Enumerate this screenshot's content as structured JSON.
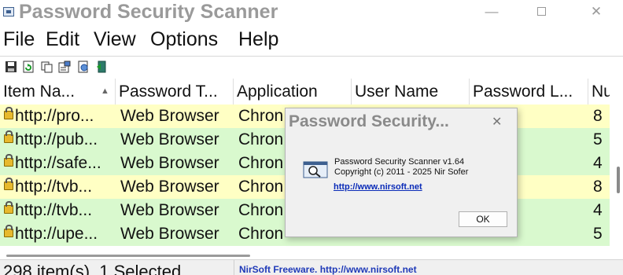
{
  "window": {
    "title": "Password Security Scanner",
    "minimize_glyph": "—",
    "close_glyph": "✕"
  },
  "menu": [
    "File",
    "Edit",
    "View",
    "Options",
    "Help"
  ],
  "toolbar": {
    "buttons": [
      "save-icon",
      "refresh-icon",
      "copy-icon",
      "properties-icon",
      "html-report-icon",
      "exit-icon"
    ]
  },
  "table": {
    "sort_indicator": "▲",
    "columns": [
      "Item Na...",
      "Password T...",
      "Application",
      "User Name",
      "Password L...",
      "Nu"
    ],
    "rows": [
      {
        "item": "http://pro...",
        "type": "Web Browser",
        "app": "Chron",
        "length": "8"
      },
      {
        "item": "http://pub...",
        "type": "Web Browser",
        "app": "Chron",
        "length": "5"
      },
      {
        "item": "http://safe...",
        "type": "Web Browser",
        "app": "Chron",
        "length": "4"
      },
      {
        "item": "http://tvb...",
        "type": "Web Browser",
        "app": "Chron",
        "length": "8"
      },
      {
        "item": "http://tvb...",
        "type": "Web Browser",
        "app": "Chron",
        "length": "4"
      },
      {
        "item": "http://upe...",
        "type": "Web Browser",
        "app": "Chron",
        "length": "5"
      }
    ]
  },
  "status": {
    "left": "298 item(s), 1 Selected",
    "right": "NirSoft Freeware.  http://www.nirsoft.net"
  },
  "dialog": {
    "title": "Password Security...",
    "close_glyph": "✕",
    "line1": "Password Security Scanner v1.64",
    "line2": "Copyright (c) 2011 - 2025 Nir Sofer",
    "link": "http://www.nirsoft.net",
    "ok_label": "OK"
  },
  "colors": {
    "row_yellow": "#ffffc4",
    "row_green": "#d9f9ce",
    "link_blue": "#0a2bb8"
  }
}
